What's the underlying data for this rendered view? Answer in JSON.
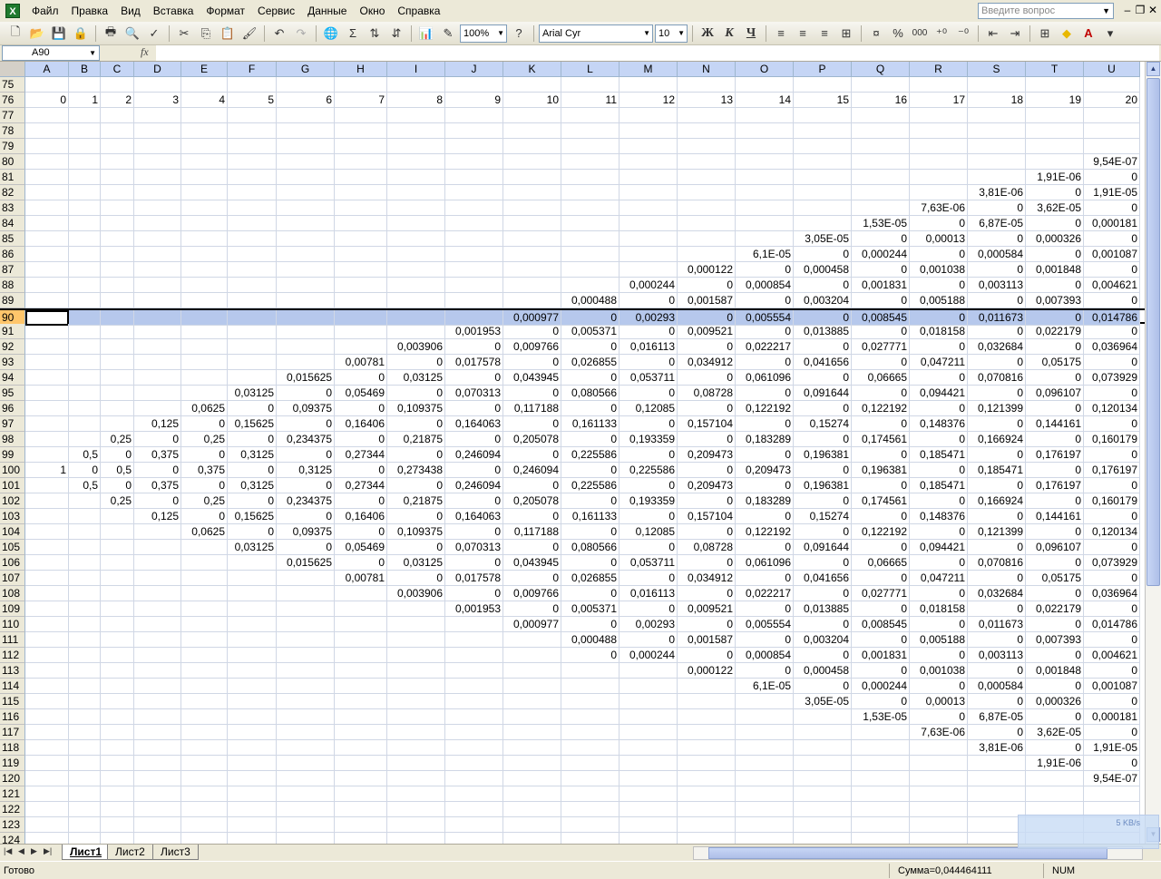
{
  "menubar": {
    "items": [
      "Файл",
      "Правка",
      "Вид",
      "Вставка",
      "Формат",
      "Сервис",
      "Данные",
      "Окно",
      "Справка"
    ],
    "help_placeholder": "Введите вопрос"
  },
  "toolbar": {
    "zoom": "100%",
    "font_name": "Arial Cyr",
    "font_size": "10",
    "bold": "Ж",
    "italic": "К",
    "underline": "Ч",
    "sigma": "Σ",
    "percent": "%",
    "thousands": "000"
  },
  "formula_bar": {
    "name_box": "A90",
    "fx": "fx",
    "value": ""
  },
  "columns": [
    "A",
    "B",
    "C",
    "D",
    "E",
    "F",
    "G",
    "H",
    "I",
    "J",
    "K",
    "L",
    "M",
    "N",
    "O",
    "P",
    "Q",
    "R",
    "S",
    "T",
    "U"
  ],
  "rows": [
    {
      "n": "75",
      "c": {}
    },
    {
      "n": "76",
      "c": {
        "A": "0",
        "B": "1",
        "C": "2",
        "D": "3",
        "E": "4",
        "F": "5",
        "G": "6",
        "H": "7",
        "I": "8",
        "J": "9",
        "K": "10",
        "L": "11",
        "M": "12",
        "N": "13",
        "O": "14",
        "P": "15",
        "Q": "16",
        "R": "17",
        "S": "18",
        "T": "19",
        "U": "20"
      }
    },
    {
      "n": "77",
      "c": {}
    },
    {
      "n": "78",
      "c": {}
    },
    {
      "n": "79",
      "c": {}
    },
    {
      "n": "80",
      "c": {
        "U": "9,54E-07"
      }
    },
    {
      "n": "81",
      "c": {
        "T": "1,91E-06",
        "U": "0"
      }
    },
    {
      "n": "82",
      "c": {
        "S": "3,81E-06",
        "T": "0",
        "U": "1,91E-05"
      }
    },
    {
      "n": "83",
      "c": {
        "R": "7,63E-06",
        "S": "0",
        "T": "3,62E-05",
        "U": "0"
      }
    },
    {
      "n": "84",
      "c": {
        "Q": "1,53E-05",
        "R": "0",
        "S": "6,87E-05",
        "T": "0",
        "U": "0,000181"
      }
    },
    {
      "n": "85",
      "c": {
        "P": "3,05E-05",
        "Q": "0",
        "R": "0,00013",
        "S": "0",
        "T": "0,000326",
        "U": "0"
      }
    },
    {
      "n": "86",
      "c": {
        "O": "6,1E-05",
        "P": "0",
        "Q": "0,000244",
        "R": "0",
        "S": "0,000584",
        "T": "0",
        "U": "0,001087"
      }
    },
    {
      "n": "87",
      "c": {
        "N": "0,000122",
        "O": "0",
        "P": "0,000458",
        "Q": "0",
        "R": "0,001038",
        "S": "0",
        "T": "0,001848",
        "U": "0"
      }
    },
    {
      "n": "88",
      "c": {
        "M": "0,000244",
        "N": "0",
        "O": "0,000854",
        "P": "0",
        "Q": "0,001831",
        "R": "0",
        "S": "0,003113",
        "T": "0",
        "U": "0,004621"
      }
    },
    {
      "n": "89",
      "c": {
        "L": "0,000488",
        "M": "0",
        "N": "0,001587",
        "O": "0",
        "P": "0,003204",
        "Q": "0",
        "R": "0,005188",
        "S": "0",
        "T": "0,007393",
        "U": "0"
      }
    },
    {
      "n": "90",
      "selected": true,
      "c": {
        "K": "0,000977",
        "L": "0",
        "M": "0,00293",
        "N": "0",
        "O": "0,005554",
        "P": "0",
        "Q": "0,008545",
        "R": "0",
        "S": "0,011673",
        "T": "0",
        "U": "0,014786"
      }
    },
    {
      "n": "91",
      "c": {
        "J": "0,001953",
        "K": "0",
        "L": "0,005371",
        "M": "0",
        "N": "0,009521",
        "O": "0",
        "P": "0,013885",
        "Q": "0",
        "R": "0,018158",
        "S": "0",
        "T": "0,022179",
        "U": "0"
      }
    },
    {
      "n": "92",
      "c": {
        "I": "0,003906",
        "J": "0",
        "K": "0,009766",
        "L": "0",
        "M": "0,016113",
        "N": "0",
        "O": "0,022217",
        "P": "0",
        "Q": "0,027771",
        "R": "0",
        "S": "0,032684",
        "T": "0",
        "U": "0,036964"
      }
    },
    {
      "n": "93",
      "c": {
        "H": "0,00781",
        "I": "0",
        "J": "0,017578",
        "K": "0",
        "L": "0,026855",
        "M": "0",
        "N": "0,034912",
        "O": "0",
        "P": "0,041656",
        "Q": "0",
        "R": "0,047211",
        "S": "0",
        "T": "0,05175",
        "U": "0"
      }
    },
    {
      "n": "94",
      "c": {
        "G": "0,015625",
        "H": "0",
        "I": "0,03125",
        "J": "0",
        "K": "0,043945",
        "L": "0",
        "M": "0,053711",
        "N": "0",
        "O": "0,061096",
        "P": "0",
        "Q": "0,06665",
        "R": "0",
        "S": "0,070816",
        "T": "0",
        "U": "0,073929"
      }
    },
    {
      "n": "95",
      "c": {
        "F": "0,03125",
        "G": "0",
        "H": "0,05469",
        "I": "0",
        "J": "0,070313",
        "K": "0",
        "L": "0,080566",
        "M": "0",
        "N": "0,08728",
        "O": "0",
        "P": "0,091644",
        "Q": "0",
        "R": "0,094421",
        "S": "0",
        "T": "0,096107",
        "U": "0"
      }
    },
    {
      "n": "96",
      "c": {
        "E": "0,0625",
        "F": "0",
        "G": "0,09375",
        "H": "0",
        "I": "0,109375",
        "J": "0",
        "K": "0,117188",
        "L": "0",
        "M": "0,12085",
        "N": "0",
        "O": "0,122192",
        "P": "0",
        "Q": "0,122192",
        "R": "0",
        "S": "0,121399",
        "T": "0",
        "U": "0,120134"
      }
    },
    {
      "n": "97",
      "c": {
        "D": "0,125",
        "E": "0",
        "F": "0,15625",
        "G": "0",
        "H": "0,16406",
        "I": "0",
        "J": "0,164063",
        "K": "0",
        "L": "0,161133",
        "M": "0",
        "N": "0,157104",
        "O": "0",
        "P": "0,15274",
        "Q": "0",
        "R": "0,148376",
        "S": "0",
        "T": "0,144161",
        "U": "0"
      }
    },
    {
      "n": "98",
      "c": {
        "C": "0,25",
        "D": "0",
        "E": "0,25",
        "F": "0",
        "G": "0,234375",
        "H": "0",
        "I": "0,21875",
        "J": "0",
        "K": "0,205078",
        "L": "0",
        "M": "0,193359",
        "N": "0",
        "O": "0,183289",
        "P": "0",
        "Q": "0,174561",
        "R": "0",
        "S": "0,166924",
        "T": "0",
        "U": "0,160179"
      }
    },
    {
      "n": "99",
      "c": {
        "B": "0,5",
        "C": "0",
        "D": "0,375",
        "E": "0",
        "F": "0,3125",
        "G": "0",
        "H": "0,27344",
        "I": "0",
        "J": "0,246094",
        "K": "0",
        "L": "0,225586",
        "M": "0",
        "N": "0,209473",
        "O": "0",
        "P": "0,196381",
        "Q": "0",
        "R": "0,185471",
        "S": "0",
        "T": "0,176197",
        "U": "0"
      }
    },
    {
      "n": "100",
      "c": {
        "A": "1",
        "B": "0",
        "C": "0,5",
        "D": "0",
        "E": "0,375",
        "F": "0",
        "G": "0,3125",
        "H": "0",
        "I": "0,273438",
        "J": "0",
        "K": "0,246094",
        "L": "0",
        "M": "0,225586",
        "N": "0",
        "O": "0,209473",
        "P": "0",
        "Q": "0,196381",
        "R": "0",
        "S": "0,185471",
        "T": "0",
        "U": "0,176197"
      }
    },
    {
      "n": "101",
      "c": {
        "B": "0,5",
        "C": "0",
        "D": "0,375",
        "E": "0",
        "F": "0,3125",
        "G": "0",
        "H": "0,27344",
        "I": "0",
        "J": "0,246094",
        "K": "0",
        "L": "0,225586",
        "M": "0",
        "N": "0,209473",
        "O": "0",
        "P": "0,196381",
        "Q": "0",
        "R": "0,185471",
        "S": "0",
        "T": "0,176197",
        "U": "0"
      }
    },
    {
      "n": "102",
      "c": {
        "C": "0,25",
        "D": "0",
        "E": "0,25",
        "F": "0",
        "G": "0,234375",
        "H": "0",
        "I": "0,21875",
        "J": "0",
        "K": "0,205078",
        "L": "0",
        "M": "0,193359",
        "N": "0",
        "O": "0,183289",
        "P": "0",
        "Q": "0,174561",
        "R": "0",
        "S": "0,166924",
        "T": "0",
        "U": "0,160179"
      }
    },
    {
      "n": "103",
      "c": {
        "D": "0,125",
        "E": "0",
        "F": "0,15625",
        "G": "0",
        "H": "0,16406",
        "I": "0",
        "J": "0,164063",
        "K": "0",
        "L": "0,161133",
        "M": "0",
        "N": "0,157104",
        "O": "0",
        "P": "0,15274",
        "Q": "0",
        "R": "0,148376",
        "S": "0",
        "T": "0,144161",
        "U": "0"
      }
    },
    {
      "n": "104",
      "c": {
        "E": "0,0625",
        "F": "0",
        "G": "0,09375",
        "H": "0",
        "I": "0,109375",
        "J": "0",
        "K": "0,117188",
        "L": "0",
        "M": "0,12085",
        "N": "0",
        "O": "0,122192",
        "P": "0",
        "Q": "0,122192",
        "R": "0",
        "S": "0,121399",
        "T": "0",
        "U": "0,120134"
      }
    },
    {
      "n": "105",
      "c": {
        "F": "0,03125",
        "G": "0",
        "H": "0,05469",
        "I": "0",
        "J": "0,070313",
        "K": "0",
        "L": "0,080566",
        "M": "0",
        "N": "0,08728",
        "O": "0",
        "P": "0,091644",
        "Q": "0",
        "R": "0,094421",
        "S": "0",
        "T": "0,096107",
        "U": "0"
      }
    },
    {
      "n": "106",
      "c": {
        "G": "0,015625",
        "H": "0",
        "I": "0,03125",
        "J": "0",
        "K": "0,043945",
        "L": "0",
        "M": "0,053711",
        "N": "0",
        "O": "0,061096",
        "P": "0",
        "Q": "0,06665",
        "R": "0",
        "S": "0,070816",
        "T": "0",
        "U": "0,073929"
      }
    },
    {
      "n": "107",
      "c": {
        "H": "0,00781",
        "I": "0",
        "J": "0,017578",
        "K": "0",
        "L": "0,026855",
        "M": "0",
        "N": "0,034912",
        "O": "0",
        "P": "0,041656",
        "Q": "0",
        "R": "0,047211",
        "S": "0",
        "T": "0,05175",
        "U": "0"
      }
    },
    {
      "n": "108",
      "c": {
        "I": "0,003906",
        "J": "0",
        "K": "0,009766",
        "L": "0",
        "M": "0,016113",
        "N": "0",
        "O": "0,022217",
        "P": "0",
        "Q": "0,027771",
        "R": "0",
        "S": "0,032684",
        "T": "0",
        "U": "0,036964"
      }
    },
    {
      "n": "109",
      "c": {
        "J": "0,001953",
        "K": "0",
        "L": "0,005371",
        "M": "0",
        "N": "0,009521",
        "O": "0",
        "P": "0,013885",
        "Q": "0",
        "R": "0,018158",
        "S": "0",
        "T": "0,022179",
        "U": "0"
      }
    },
    {
      "n": "110",
      "c": {
        "K": "0,000977",
        "L": "0",
        "M": "0,00293",
        "N": "0",
        "O": "0,005554",
        "P": "0",
        "Q": "0,008545",
        "R": "0",
        "S": "0,011673",
        "T": "0",
        "U": "0,014786"
      }
    },
    {
      "n": "111",
      "c": {
        "L": "0,000488",
        "M": "0",
        "N": "0,001587",
        "O": "0",
        "P": "0,003204",
        "Q": "0",
        "R": "0,005188",
        "S": "0",
        "T": "0,007393",
        "U": "0"
      }
    },
    {
      "n": "112",
      "c": {
        "L": "0",
        "M": "0,000244",
        "N": "0",
        "O": "0,000854",
        "P": "0",
        "Q": "0,001831",
        "R": "0",
        "S": "0,003113",
        "T": "0",
        "U": "0,004621"
      }
    },
    {
      "n": "113",
      "c": {
        "N": "0,000122",
        "O": "0",
        "P": "0,000458",
        "Q": "0",
        "R": "0,001038",
        "S": "0",
        "T": "0,001848",
        "U": "0"
      }
    },
    {
      "n": "114",
      "c": {
        "O": "6,1E-05",
        "P": "0",
        "Q": "0,000244",
        "R": "0",
        "S": "0,000584",
        "T": "0",
        "U": "0,001087"
      }
    },
    {
      "n": "115",
      "c": {
        "P": "3,05E-05",
        "Q": "0",
        "R": "0,00013",
        "S": "0",
        "T": "0,000326",
        "U": "0"
      }
    },
    {
      "n": "116",
      "c": {
        "Q": "1,53E-05",
        "R": "0",
        "S": "6,87E-05",
        "T": "0",
        "U": "0,000181"
      }
    },
    {
      "n": "117",
      "c": {
        "R": "7,63E-06",
        "S": "0",
        "T": "3,62E-05",
        "U": "0"
      }
    },
    {
      "n": "118",
      "c": {
        "S": "3,81E-06",
        "T": "0",
        "U": "1,91E-05"
      }
    },
    {
      "n": "119",
      "c": {
        "T": "1,91E-06",
        "U": "0"
      }
    },
    {
      "n": "120",
      "c": {
        "U": "9,54E-07"
      }
    },
    {
      "n": "121",
      "c": {}
    },
    {
      "n": "122",
      "c": {}
    },
    {
      "n": "123",
      "c": {}
    },
    {
      "n": "124",
      "c": {}
    }
  ],
  "sheet_tabs": [
    "Лист1",
    "Лист2",
    "Лист3"
  ],
  "status": {
    "ready": "Готово",
    "sum": "Сумма=0,044464111",
    "num": "NUM"
  },
  "net_widget": "5 KB/s"
}
